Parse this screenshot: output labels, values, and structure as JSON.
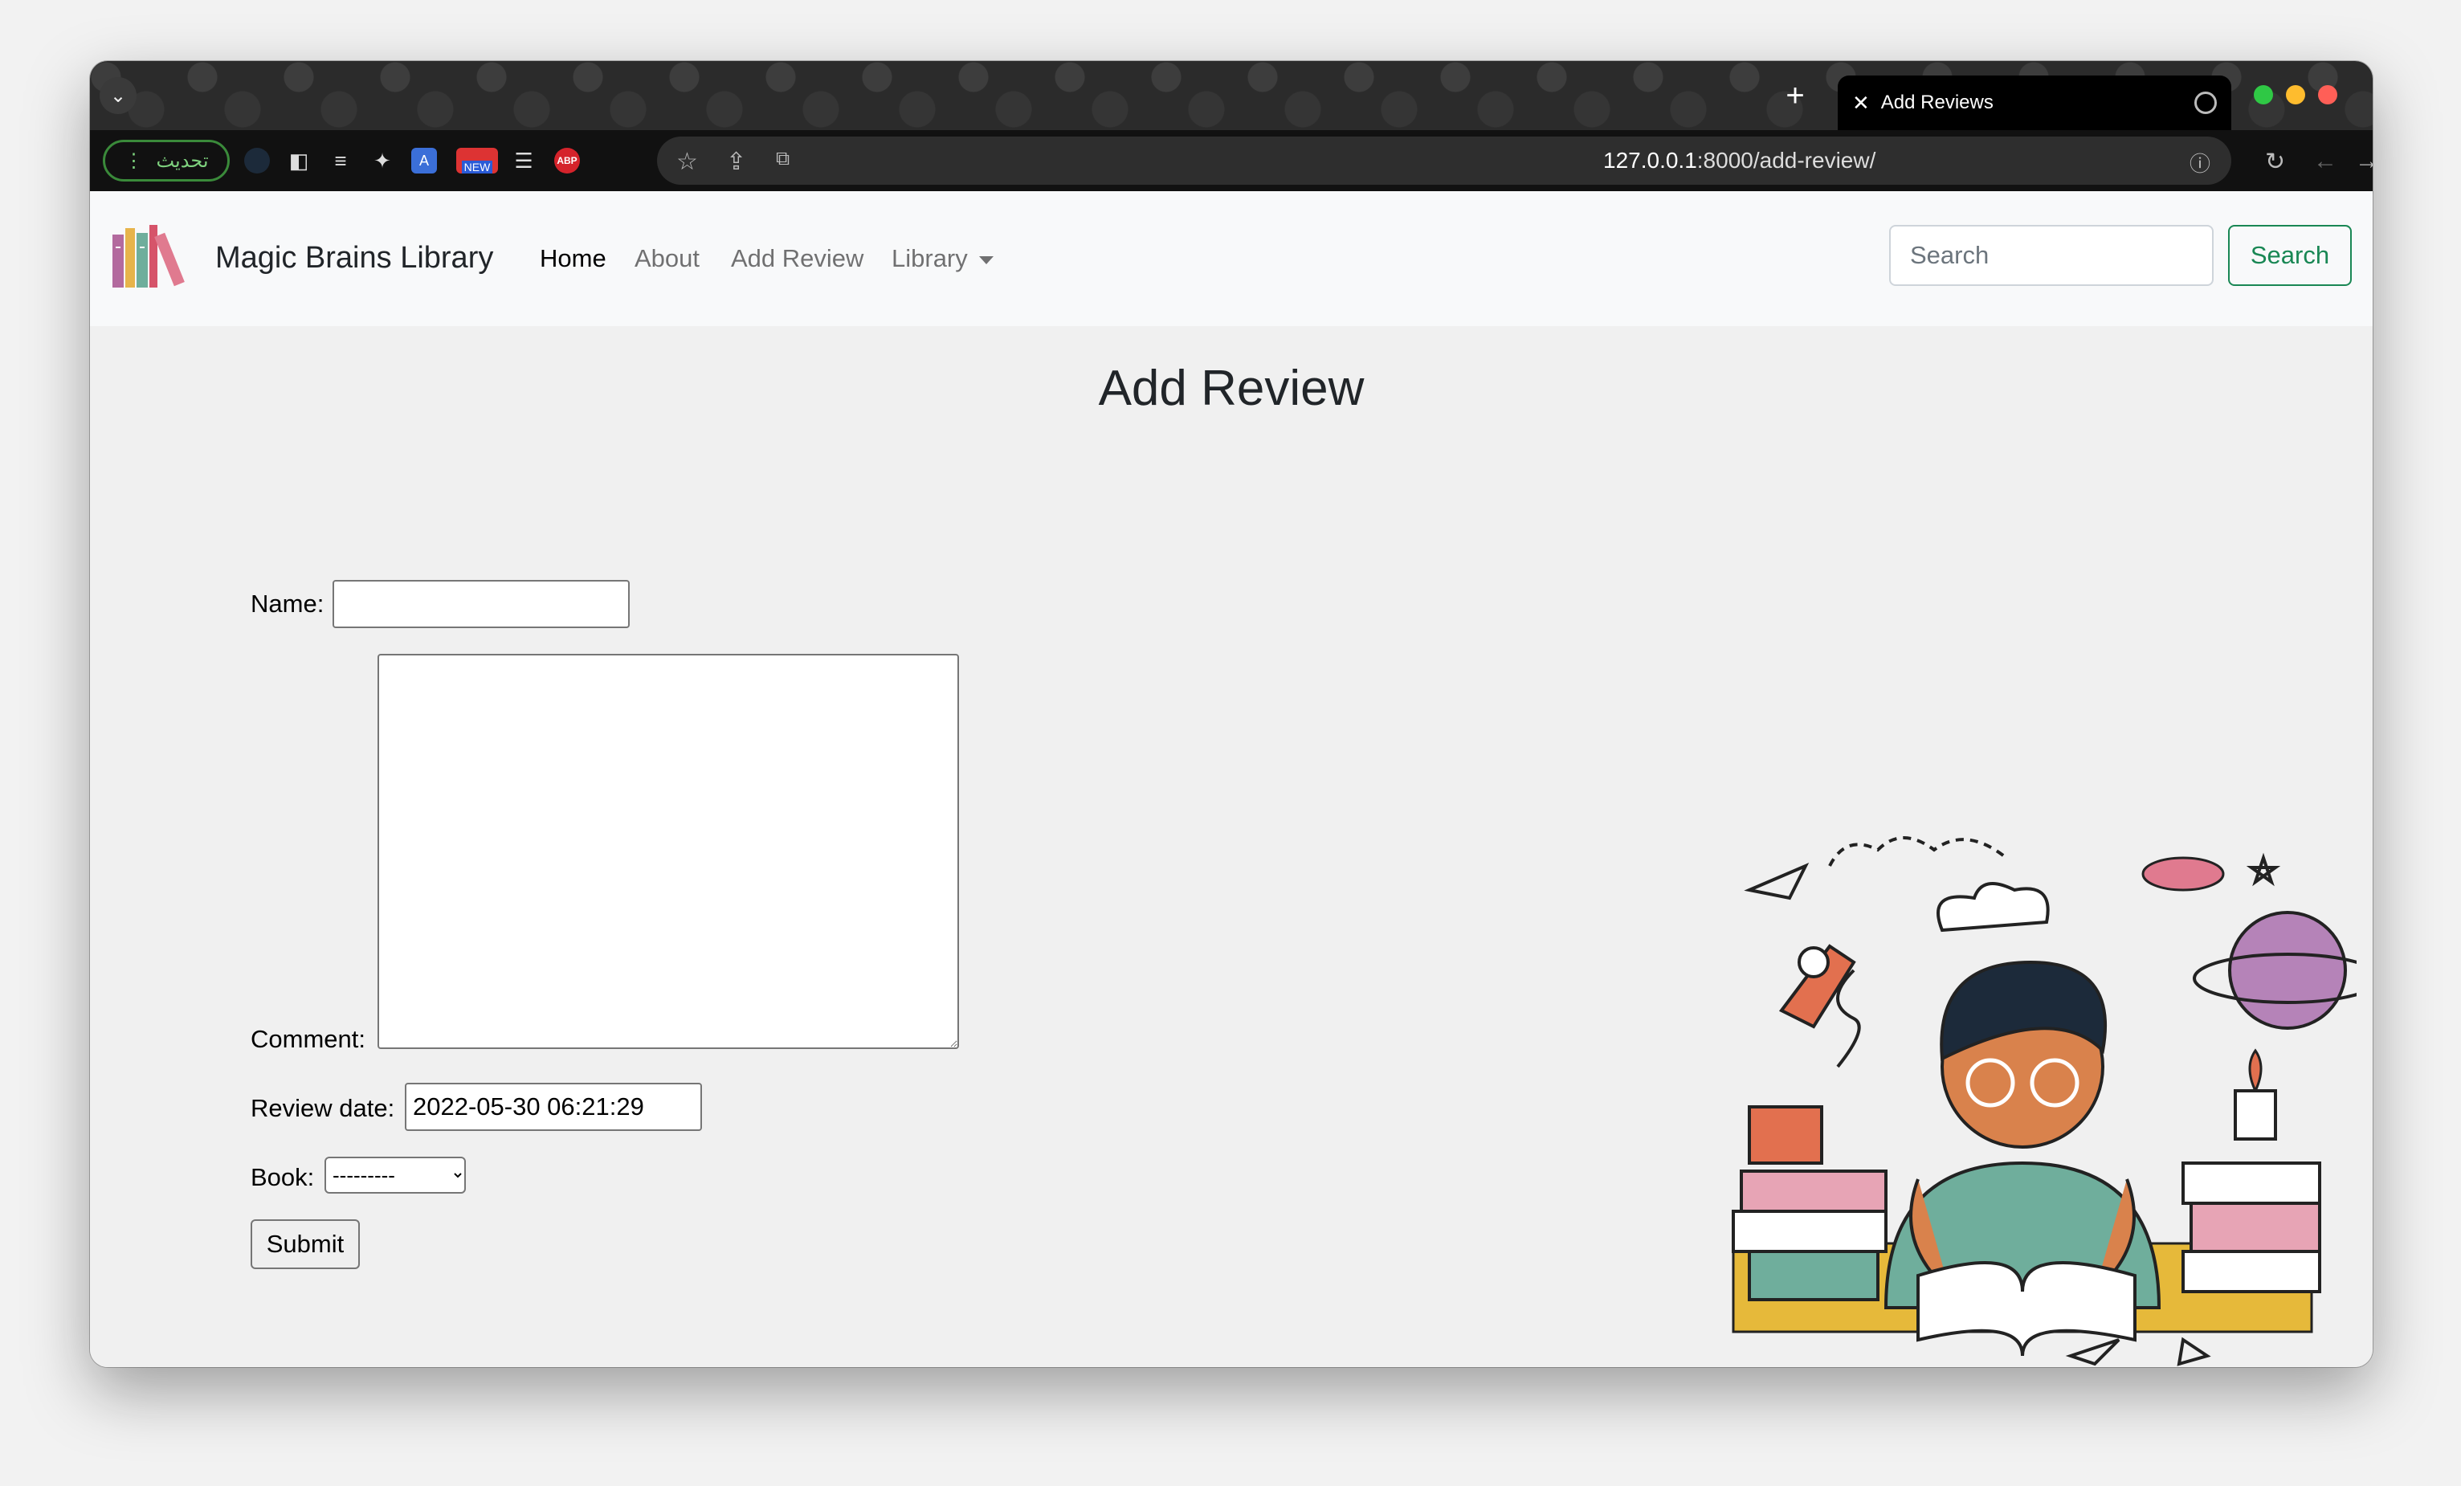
{
  "browser": {
    "tab_title": "Add Reviews",
    "update_button": "تحديث",
    "url_host": "127.0.0.1",
    "url_path": ":8000/add-review/",
    "ext_new_badge": "NEW",
    "ext_abp_label": "ABP"
  },
  "navbar": {
    "brand": "Magic Brains Library",
    "links": [
      "Home",
      "About",
      "Add Review",
      "Library"
    ],
    "search_placeholder": "Search",
    "search_button": "Search"
  },
  "main": {
    "title": "Add Review",
    "form": {
      "name_label": "Name:",
      "name_value": "",
      "comment_label": "Comment:",
      "review_date_label": "Review date:",
      "review_date_value": "2022-05-30 06:21:29",
      "book_label": "Book:",
      "book_selected": "---------",
      "submit_label": "Submit"
    }
  },
  "colors": {
    "accent_green": "#198754",
    "navbar_bg": "#f8f9fa",
    "page_bg": "#f0f0f0"
  }
}
